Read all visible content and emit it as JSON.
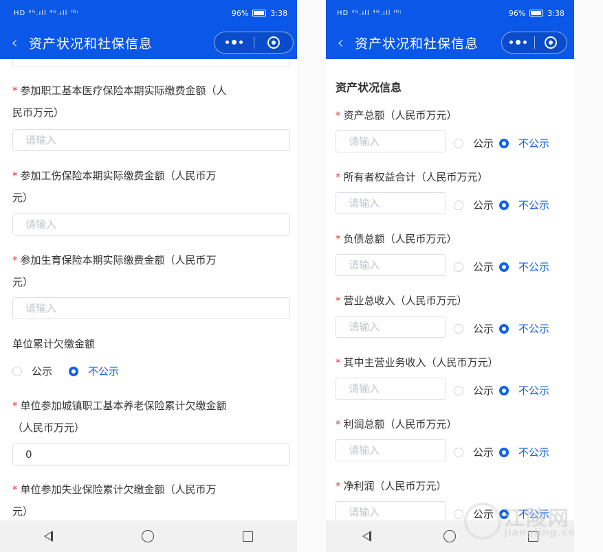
{
  "status": {
    "signal": "HD ⁴ᴳ.ıll ⁴ᴳ.ıll ᴵᴼᵎ",
    "battery": "96%",
    "time": "3:38"
  },
  "nav": {
    "back_icon": "chevron-left-icon",
    "title": "资产状况和社保信息",
    "more_icon": "more-dots-icon",
    "close_icon": "target-close-icon"
  },
  "left": {
    "fields": [
      {
        "label_line1": "参加职工基本医疗保险本期实际缴费金额（人",
        "label_line2": "民币万元）",
        "placeholder": "请输入"
      },
      {
        "label_line1": "参加工伤保险本期实际缴费金额（人民币万",
        "label_line2": "元）",
        "placeholder": "请输入"
      },
      {
        "label_line1": "参加生育保险本期实际缴费金额（人民币万",
        "label_line2": "元）",
        "placeholder": "请输入"
      }
    ],
    "arrears_title": "单位累计欠缴金额",
    "arrears_public": "公示",
    "arrears_private": "不公示",
    "pension_line1": "单位参加城镇职工基本养老保险累计欠缴金额",
    "pension_line2": "（人民币万元）",
    "pension_value": "0",
    "unemployment_line1": "单位参加失业保险累计欠缴金额（人民币万",
    "unemployment_line2": "元）"
  },
  "right": {
    "section_title": "资产状况信息",
    "placeholder": "请输入",
    "public_label": "公示",
    "private_label": "不公示",
    "fields": [
      {
        "label": "资产总额（人民币万元）"
      },
      {
        "label": "所有者权益合计（人民币万元）"
      },
      {
        "label": "负债总额（人民币万元）"
      },
      {
        "label": "营业总收入（人民币万元）"
      },
      {
        "label": "其中主营业务收入（人民币万元）"
      },
      {
        "label": "利润总额（人民币万元）"
      },
      {
        "label": "净利润（人民币万元）"
      }
    ]
  },
  "watermark": {
    "text": "江陵网",
    "url": "jiangling.cn"
  },
  "colors": {
    "brand": "#0b57e8",
    "radio_active": "#1264e6",
    "required": "#e4393c"
  }
}
